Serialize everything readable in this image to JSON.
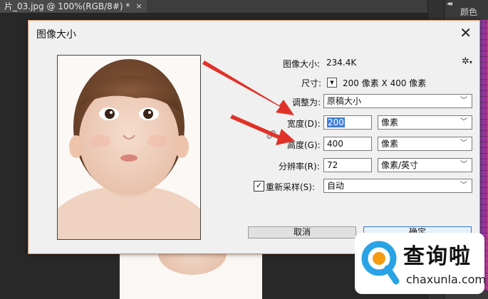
{
  "app": {
    "tab_title": "片_03.jpg @ 100%(RGB/8#) *",
    "tab_close": "×",
    "panel_collapse": "◂◂",
    "panel_tab": "颜色"
  },
  "dialog": {
    "title": "图像大小",
    "close": "✕",
    "gear": "✲",
    "image_size_label": "图像大小:",
    "image_size_value": "234.4K",
    "dimensions_label": "尺寸:",
    "dimensions_value": "200 像素 X 400 像素",
    "fit_to_label": "调整为:",
    "fit_to_value": "原稿大小",
    "width_label": "宽度(D):",
    "width_value": "200",
    "width_unit": "像素",
    "height_label": "高度(G):",
    "height_value": "400",
    "height_unit": "像素",
    "resolution_label": "分辨率(R):",
    "resolution_value": "72",
    "resolution_unit": "像素/英寸",
    "resample_label": "重新采样(S):",
    "resample_checked": true,
    "resample_value": "自动",
    "cancel_label": "取消",
    "ok_label": "确定"
  },
  "icons": {
    "gear": "gear-icon",
    "link": "link-icon",
    "dropdown": "chevron-down-icon",
    "close": "close-icon",
    "arrow_color": "#e03228"
  },
  "watermark": {
    "brand": "查询啦",
    "url": "chaxunla.com",
    "color": "#29a3e5"
  }
}
